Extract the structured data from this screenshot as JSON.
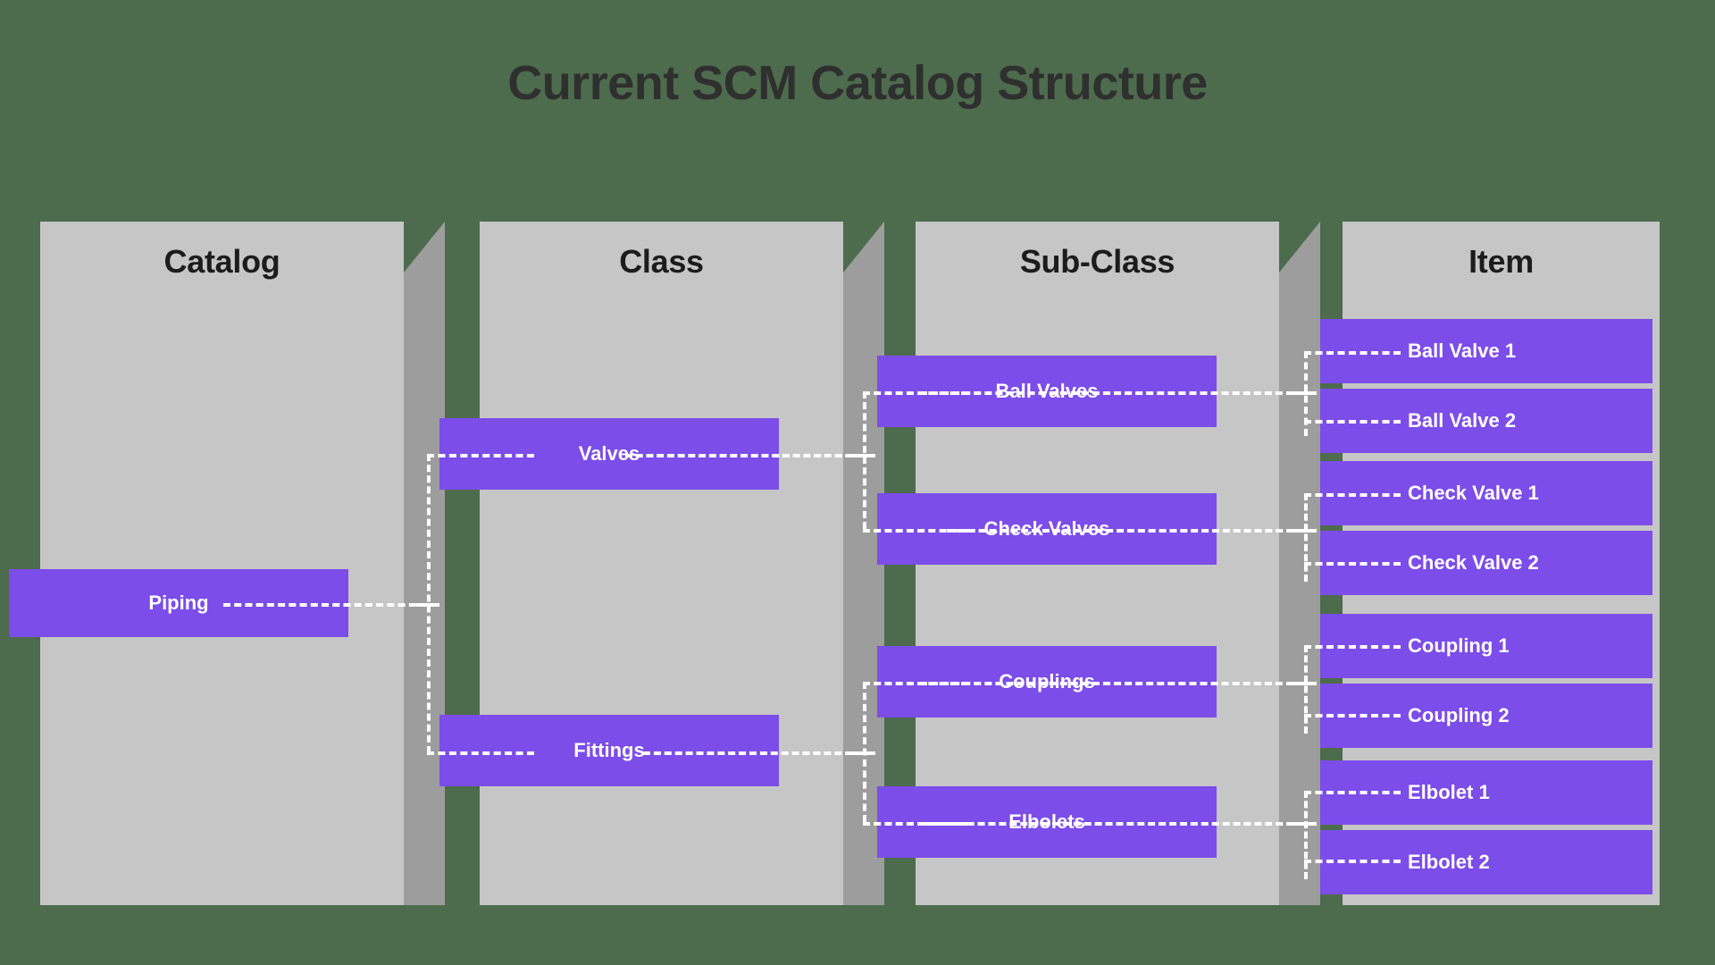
{
  "title": "Current SCM Catalog Structure",
  "theme": {
    "background": "#4d6b4d",
    "panel_face": "#c6c6c6",
    "panel_side": "#9d9d9d",
    "node_purple": "#7c4de8",
    "title_color": "#2f2f2f",
    "connector_color": "#ffffff"
  },
  "columns": [
    {
      "header": "Catalog"
    },
    {
      "header": "Class"
    },
    {
      "header": "Sub-Class"
    },
    {
      "header": "Item"
    }
  ],
  "catalog": {
    "nodes": [
      {
        "label": "Piping"
      }
    ]
  },
  "classes": {
    "nodes": [
      {
        "label": "Valves"
      },
      {
        "label": "Fittings"
      }
    ]
  },
  "subclasses": {
    "nodes": [
      {
        "label": "Ball Valves"
      },
      {
        "label": "Check Valves"
      },
      {
        "label": "Couplings"
      },
      {
        "label": "Elbolets"
      }
    ]
  },
  "items": {
    "nodes": [
      {
        "label": "Ball Valve 1"
      },
      {
        "label": "Ball Valve 2"
      },
      {
        "label": "Check Valve 1"
      },
      {
        "label": "Check Valve 2"
      },
      {
        "label": "Coupling 1"
      },
      {
        "label": "Coupling 2"
      },
      {
        "label": "Elbolet 1"
      },
      {
        "label": "Elbolet 2"
      }
    ]
  },
  "relationships": [
    {
      "from": "Piping",
      "to": [
        "Valves",
        "Fittings"
      ]
    },
    {
      "from": "Valves",
      "to": [
        "Ball Valves",
        "Check Valves"
      ]
    },
    {
      "from": "Fittings",
      "to": [
        "Couplings",
        "Elbolets"
      ]
    },
    {
      "from": "Ball Valves",
      "to": [
        "Ball Valve 1",
        "Ball Valve 2"
      ]
    },
    {
      "from": "Check Valves",
      "to": [
        "Check Valve 1",
        "Check Valve 2"
      ]
    },
    {
      "from": "Couplings",
      "to": [
        "Coupling 1",
        "Coupling 2"
      ]
    },
    {
      "from": "Elbolets",
      "to": [
        "Elbolet 1",
        "Elbolet 2"
      ]
    }
  ]
}
